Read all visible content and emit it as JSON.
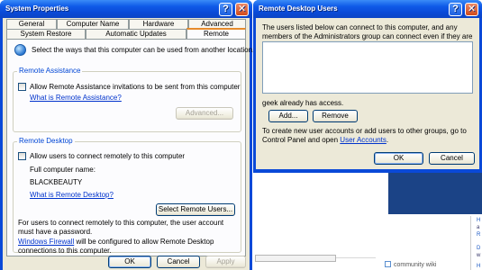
{
  "system_properties": {
    "title": "System Properties",
    "tabs_row1": [
      "General",
      "Computer Name",
      "Hardware",
      "Advanced"
    ],
    "tabs_row2": [
      "System Restore",
      "Automatic Updates",
      "Remote"
    ],
    "intro": "Select the ways that this computer can be used from another location.",
    "remote_assistance": {
      "legend": "Remote Assistance",
      "checkbox_label": "Allow Remote Assistance invitations to be sent from this computer",
      "checked": false,
      "link": "What is Remote Assistance?",
      "advanced_button": "Advanced..."
    },
    "remote_desktop": {
      "legend": "Remote Desktop",
      "checkbox_label": "Allow users to connect remotely to this computer",
      "checked": false,
      "full_name_label": "Full computer name:",
      "computer_name": "BLACKBEAUTY",
      "link": "What is Remote Desktop?",
      "select_users_button": "Select Remote Users...",
      "password_note": "For users to connect remotely to this computer, the user account must have a password.",
      "firewall_link": "Windows Firewall",
      "firewall_text": " will be configured to allow Remote Desktop connections to this computer."
    },
    "ok_button": "OK",
    "cancel_button": "Cancel",
    "apply_button": "Apply"
  },
  "remote_desktop_users": {
    "title": "Remote Desktop Users",
    "description": "The users listed below can connect to this computer, and any members of the Administrators group can connect even if they are not listed.",
    "users": [],
    "access_note": "geek already has access.",
    "add_button": "Add...",
    "remove_button": "Remove",
    "info_text": "To create new user accounts or add users to other groups, go to Control Panel and open ",
    "user_accounts_link": "User Accounts",
    "info_text_end": ".",
    "ok_button": "OK",
    "cancel_button": "Cancel"
  },
  "background": {
    "community_wiki": "community wiki",
    "side_fragments": [
      "H",
      "a",
      "R",
      "D",
      "w",
      "H"
    ]
  }
}
